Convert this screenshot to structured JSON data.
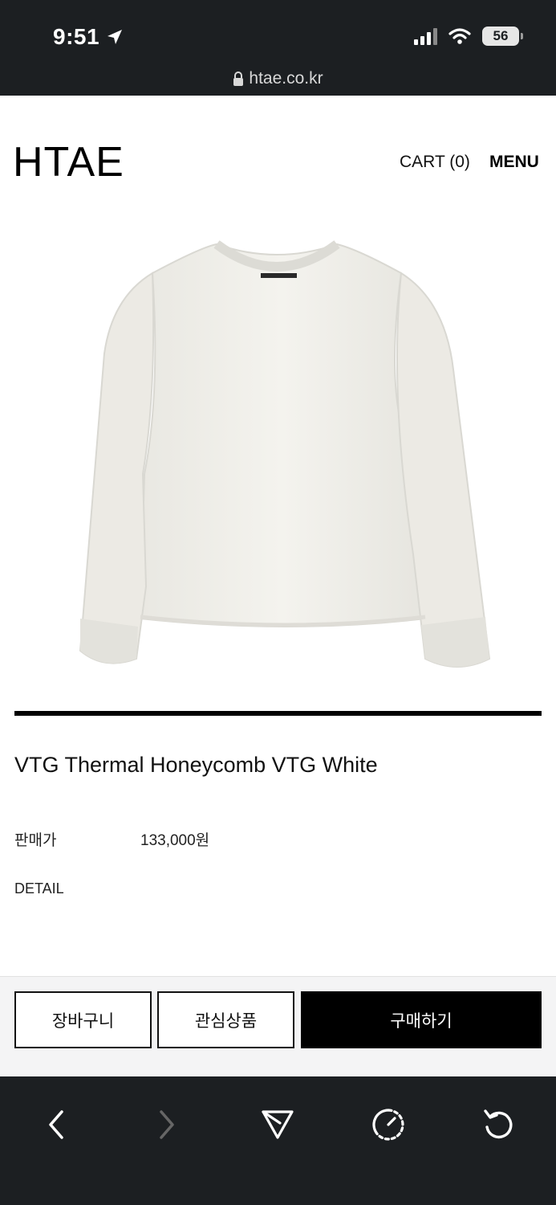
{
  "status_bar": {
    "time": "9:51",
    "battery": "56"
  },
  "browser": {
    "url": "htae.co.kr"
  },
  "header": {
    "logo": "HTAE",
    "cart": "CART (0)",
    "menu": "MENU"
  },
  "product": {
    "image_icon": "long-sleeve-thermal-shirt",
    "title": "VTG Thermal Honeycomb VTG White",
    "price_label": "판매가",
    "price": "133,000원",
    "detail_label": "DETAIL"
  },
  "actions": {
    "cart": "장바구니",
    "wishlist": "관심상품",
    "buy": "구매하기"
  },
  "toolbar": {
    "icons": [
      "back-icon",
      "forward-icon",
      "share-icon",
      "speed-icon",
      "reload-icon"
    ]
  },
  "colors": {
    "chrome": "#1c1f22",
    "accent": "#000000",
    "action_bar": "#f4f4f5"
  }
}
